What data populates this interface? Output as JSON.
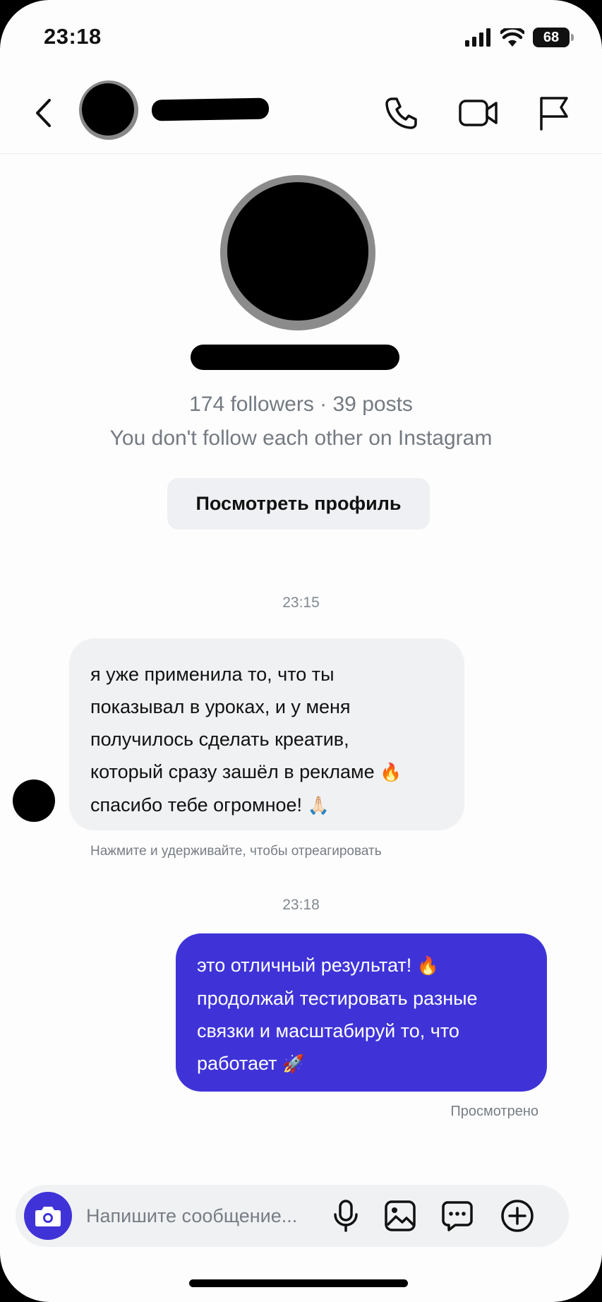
{
  "status_bar": {
    "time": "23:18",
    "battery": "68",
    "icons": [
      "signal-icon",
      "wifi-icon",
      "battery-icon"
    ]
  },
  "header": {
    "icons": [
      "chevron-left-icon",
      "phone-icon",
      "video-camera-icon",
      "flag-icon"
    ]
  },
  "profile": {
    "stats": "174 followers · 39 posts",
    "follow_note": "You don't follow each other on Instagram",
    "view_profile_label": "Посмотреть профиль"
  },
  "conversation": {
    "timestamp_1": "23:15",
    "incoming": {
      "lines": [
        "я уже применила то, что ты",
        "показывал в уроках, и у меня",
        "получилось сделать креатив,",
        "который сразу зашёл в рекламе",
        "спасибо тебе огромное!"
      ],
      "emoji_1": "🔥",
      "emoji_2": "🙏🏻"
    },
    "react_hint": "Нажмите и удерживайте, чтобы отреагировать",
    "timestamp_2": "23:18",
    "outgoing": {
      "lines": [
        "это отличный результат!",
        "продолжай тестировать разные",
        "связки и масштабируй то, что",
        "работает"
      ],
      "emoji_1": "🔥",
      "emoji_2": "🚀"
    },
    "seen_label": "Просмотрено"
  },
  "composer": {
    "placeholder": "Напишите сообщение...",
    "icons": [
      "camera-icon",
      "microphone-icon",
      "image-icon",
      "sticker-chat-icon",
      "plus-circle-icon"
    ]
  },
  "colors": {
    "accent": "#3f33d8",
    "bubble_in": "#f0f1f3",
    "secondary_text": "#747a82"
  }
}
